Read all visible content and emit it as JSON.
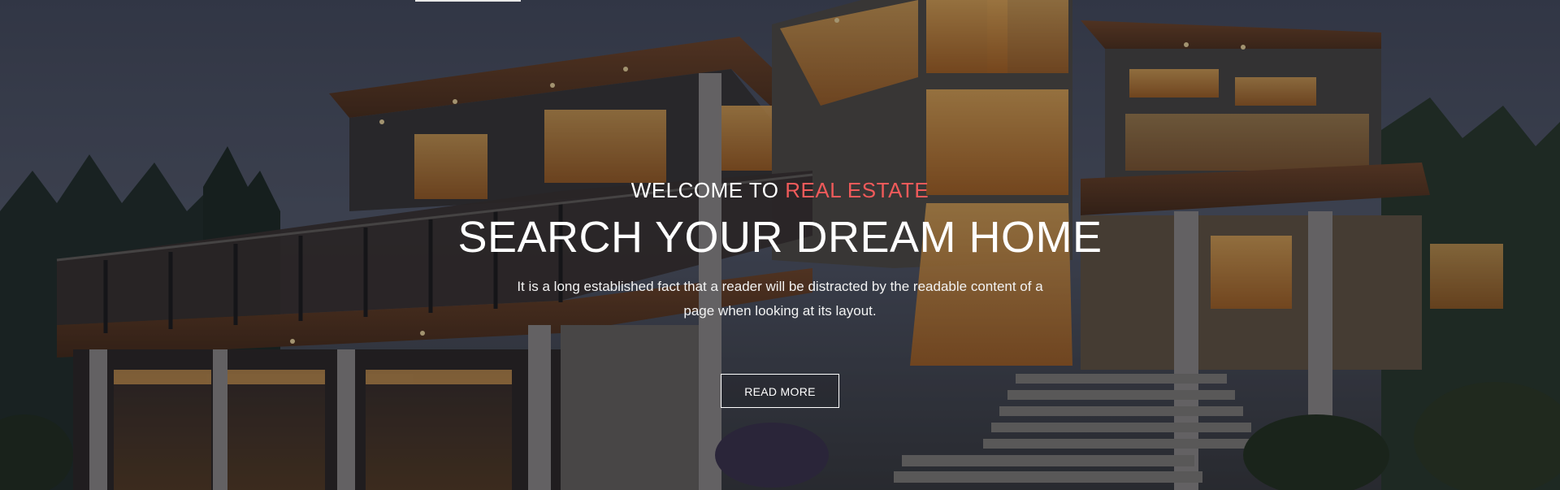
{
  "hero": {
    "welcome_prefix": "WELCOME TO",
    "welcome_highlight": "REAL ESTATE",
    "headline": "SEARCH YOUR DREAM HOME",
    "description": "It is a long established fact that a reader will be distracted by the readable content of a page when looking at its layout.",
    "button_label": "READ MORE",
    "accent_color": "#f05a5a"
  }
}
